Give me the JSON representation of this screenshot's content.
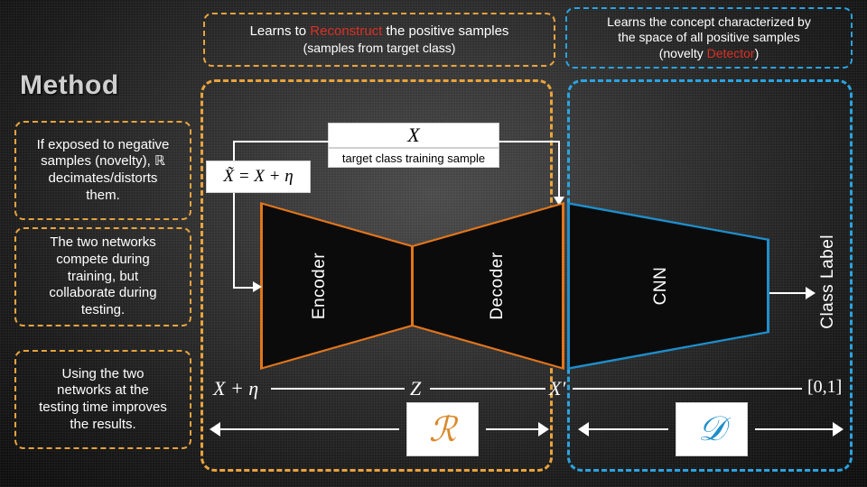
{
  "slide": {
    "title": "Method"
  },
  "callouts": {
    "reconstruct": {
      "line1_pre": "Learns to ",
      "line1_hi": "Reconstruct",
      "line1_post": " the positive samples",
      "line2": "(samples from target class)"
    },
    "concept": {
      "line1": "Learns the concept characterized by",
      "line2": "the space of all positive samples",
      "line3_pre": "(novelty ",
      "line3_hi": "Detector",
      "line3_post": ")"
    },
    "left": [
      {
        "id": "negative-samples",
        "lines": [
          "If exposed to negative",
          "samples (novelty), ℝ",
          "decimates/distorts",
          "them."
        ]
      },
      {
        "id": "compete-collaborate",
        "lines": [
          "The two networks",
          "compete during",
          "training, but",
          "collaborate during",
          "testing."
        ]
      },
      {
        "id": "testing-improves",
        "lines": [
          "Using the two",
          "networks at the",
          "testing time improves",
          "the results."
        ]
      }
    ]
  },
  "diagram": {
    "input_noise_label": "X̃ = X + η",
    "x_box_symbol": "X",
    "x_box_caption": "target class training sample",
    "encoder_label": "Encoder",
    "decoder_label": "Decoder",
    "cnn_label": "CNN",
    "class_label": "Class Label",
    "bottom_left_label": "X + η",
    "latent_label": "Z",
    "reconstructed_label": "X′",
    "output_range_label": "[0,1]",
    "r_module_glyph": "ℛ",
    "d_module_glyph": "𝒟"
  },
  "colors": {
    "orange": "#e8a33d",
    "orange_stroke": "#e2761b",
    "blue": "#2aa3e0",
    "red_highlight": "#d93025",
    "white": "#ffffff",
    "block_fill": "#0b0b0b"
  }
}
